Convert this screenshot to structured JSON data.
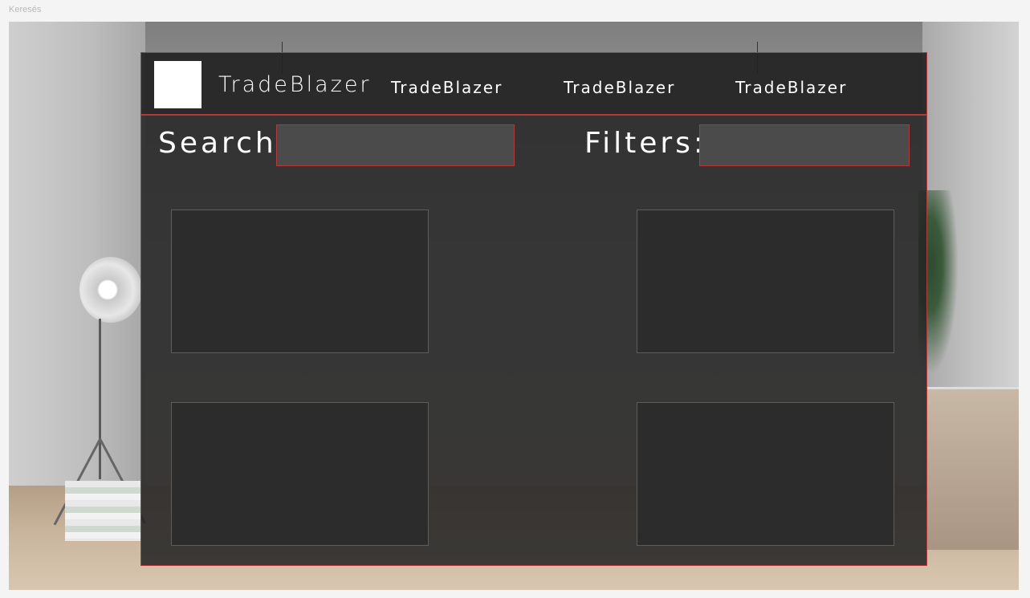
{
  "page": {
    "top_label": "Keresés"
  },
  "navbar": {
    "brand": "TradeBlazer",
    "links": [
      "TradeBlazer",
      "TradeBlazer",
      "TradeBlazer"
    ]
  },
  "search": {
    "label": "Search:",
    "value": "",
    "placeholder": ""
  },
  "filters": {
    "label": "Filters:",
    "value": "",
    "placeholder": ""
  },
  "cards": [
    "",
    "",
    "",
    ""
  ],
  "colors": {
    "accent": "#b03a3a",
    "panel": "#262626",
    "field": "#4b4b4b",
    "text": "#ffffff"
  }
}
